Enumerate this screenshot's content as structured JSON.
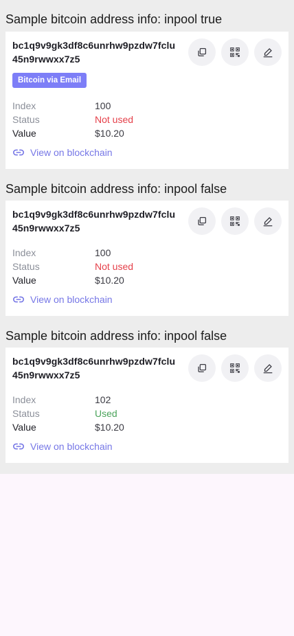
{
  "sections": [
    {
      "title": "Sample bitcoin address info: inpool true",
      "address": "bc1q9v9gk3df8c6unrhw9pzdw7fclu45n9rwwxx7z5",
      "badge": "Bitcoin via Email",
      "index_label": "Index",
      "index_value": "100",
      "status_label": "Status",
      "status_value": "Not used",
      "value_label": "Value",
      "value_value": "$10.20",
      "link_label": "View on blockchain"
    },
    {
      "title": "Sample bitcoin address info: inpool false",
      "address": "bc1q9v9gk3df8c6unrhw9pzdw7fclu45n9rwwxx7z5",
      "index_label": "Index",
      "index_value": "100",
      "status_label": "Status",
      "status_value": "Not used",
      "value_label": "Value",
      "value_value": "$10.20",
      "link_label": "View on blockchain"
    },
    {
      "title": "Sample bitcoin address info: inpool false",
      "address": "bc1q9v9gk3df8c6unrhw9pzdw7fclu45n9rwwxx7z5",
      "index_label": "Index",
      "index_value": "102",
      "status_label": "Status",
      "status_value": "Used",
      "value_label": "Value",
      "value_value": "$10.20",
      "link_label": "View on blockchain"
    }
  ],
  "colors": {
    "badge_bg": "#7d7ef7",
    "link": "#7677e6",
    "status_not_used": "#e5404a",
    "status_used": "#4aa35a"
  },
  "icons": {
    "copy": "copy-icon",
    "qr": "qr-code-icon",
    "edit": "edit-icon",
    "link": "link-icon"
  }
}
